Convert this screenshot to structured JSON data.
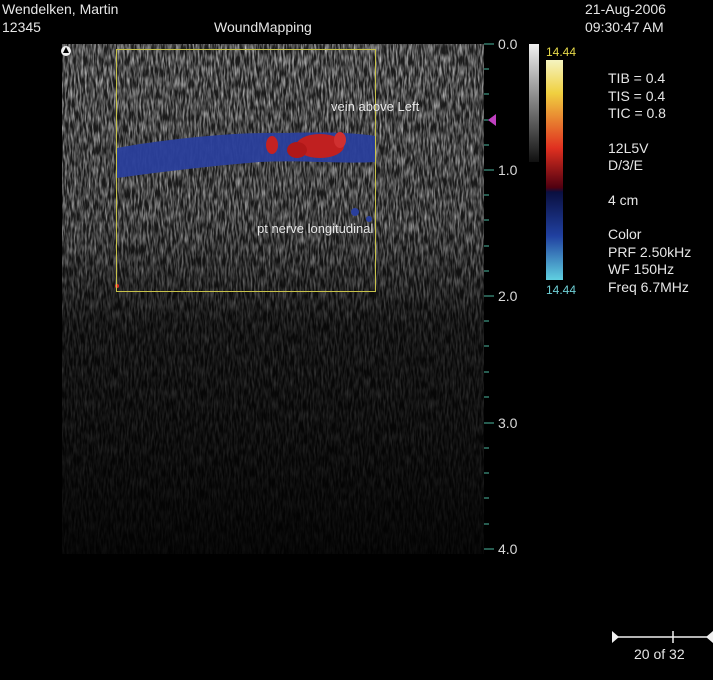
{
  "header": {
    "patient_name": "Wendelken, Martin",
    "patient_id": "12345",
    "study": "WoundMapping",
    "date": "21-Aug-2006",
    "time": "09:30:47 AM"
  },
  "depth_scale": {
    "labels": [
      "0.0",
      "1.0",
      "2.0",
      "3.0",
      "4.0"
    ]
  },
  "color_scale": {
    "top_value": "14.44",
    "bottom_value": "14.44"
  },
  "annotations": {
    "vein": "vein above Left",
    "nerve": "pt nerve longitudinal"
  },
  "params": {
    "tib": "TIB = 0.4",
    "tis": "TIS = 0.4",
    "tic": "TIC = 0.8",
    "probe": "12L5V",
    "mode": "D/3/E",
    "depth": "4 cm",
    "color": "Color",
    "prf": "PRF 2.50kHz",
    "wf": "WF 150Hz",
    "freq": "Freq 6.7MHz"
  },
  "frame_counter": "20 of 32",
  "colors": {
    "roi_border": "#c8c24a",
    "scale_tick": "#4db89f",
    "marker": "#c040c0"
  }
}
